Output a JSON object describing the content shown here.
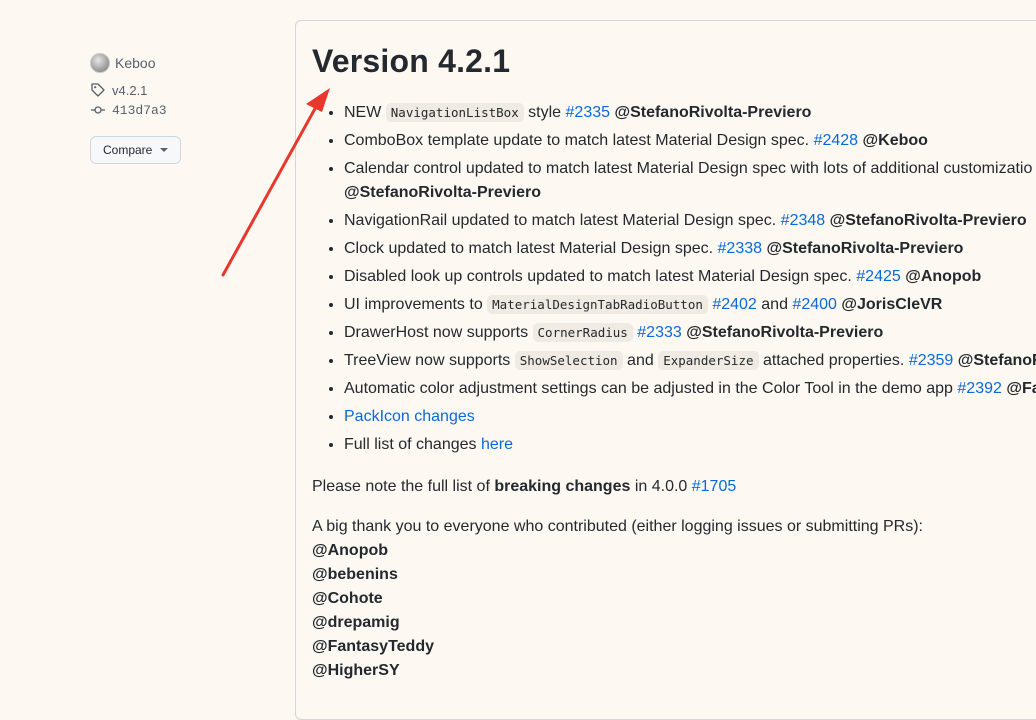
{
  "sidebar": {
    "author": "Keboo",
    "tag": "v4.2.1",
    "commit": "413d7a3",
    "compare_label": "Compare"
  },
  "release": {
    "title": "Version 4.2.1",
    "items": [
      {
        "pre": "NEW ",
        "code1": "NavigationListBox",
        "mid": " style ",
        "link1": "#2335",
        "user": "@StefanoRivolta-Previero"
      },
      {
        "pre": "ComboBox template update to match latest Material Design spec. ",
        "link1": "#2428",
        "user": "@Keboo"
      },
      {
        "pre": "Calendar control updated to match latest Material Design spec with lots of additional customizatio",
        "user2": "@StefanoRivolta-Previero"
      },
      {
        "pre": "NavigationRail updated to match latest Material Design spec. ",
        "link1": "#2348",
        "user": "@StefanoRivolta-Previero"
      },
      {
        "pre": "Clock updated to match latest Material Design spec. ",
        "link1": "#2338",
        "user": "@StefanoRivolta-Previero"
      },
      {
        "pre": "Disabled look up controls updated to match latest Material Design spec. ",
        "link1": "#2425",
        "user": "@Anopob"
      },
      {
        "pre": "UI improvements to ",
        "code1": "MaterialDesignTabRadioButton",
        "link1": "#2402",
        "and": " and ",
        "link2": "#2400",
        "user": "@JorisCleVR"
      },
      {
        "pre": "DrawerHost now supports ",
        "code1": "CornerRadius",
        "link1": "#2333",
        "user": "@StefanoRivolta-Previero"
      },
      {
        "pre": "TreeView now supports ",
        "code1": "ShowSelection",
        "and": " and ",
        "code2": "ExpanderSize",
        "post": " attached properties. ",
        "link1": "#2359",
        "user": "@StefanoRi"
      },
      {
        "pre": "Automatic color adjustment settings can be adjusted in the Color Tool in the demo app ",
        "link1": "#2392",
        "user": "@Fa"
      },
      {
        "link_text": "PackIcon changes"
      },
      {
        "pre": "Full list of changes ",
        "link_text": "here"
      }
    ],
    "note_pre": "Please note the full list of ",
    "note_bold": "breaking changes",
    "note_mid": " in 4.0.0 ",
    "note_link": "#1705",
    "thanks_text": "A big thank you to everyone who contributed (either logging issues or submitting PRs):",
    "contributors": [
      "@Anopob",
      "@bebenins",
      "@Cohote",
      "@drepamig",
      "@FantasyTeddy",
      "@HigherSY"
    ]
  },
  "colors": {
    "link": "#0969da",
    "background": "#fdf8f1",
    "arrow": "#e8372c"
  }
}
